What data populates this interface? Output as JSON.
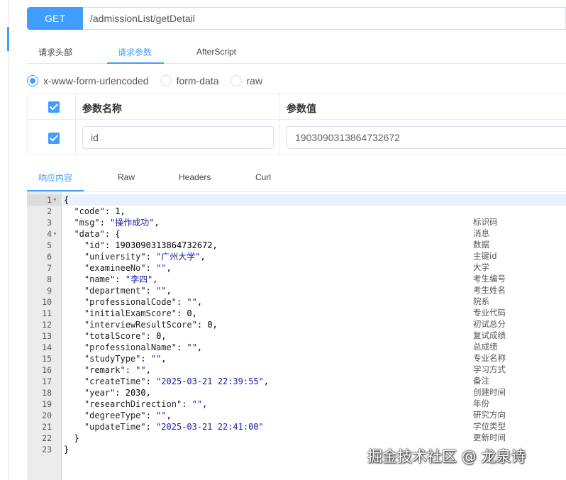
{
  "request": {
    "method": "GET",
    "url": "/admissionList/getDetail"
  },
  "request_tabs": [
    "请求头部",
    "请求参数",
    "AfterScript"
  ],
  "active_request_tab": "请求参数",
  "body_types": [
    "x-www-form-urlencoded",
    "form-data",
    "raw"
  ],
  "selected_body_type": "x-www-form-urlencoded",
  "params_table": {
    "headers": {
      "name": "参数名称",
      "value": "参数值"
    },
    "rows": [
      {
        "checked": true,
        "name": "id",
        "value": "1903090313864732672"
      }
    ]
  },
  "response_tabs": [
    "响应内容",
    "Raw",
    "Headers",
    "Curl"
  ],
  "active_response_tab": "响应内容",
  "editor": {
    "lines": [
      {
        "n": "1",
        "fold": true,
        "code": [
          [
            "p",
            "{"
          ]
        ],
        "comment": ""
      },
      {
        "n": "2",
        "code": [
          [
            "p",
            "  "
          ],
          [
            "k",
            "\"code\""
          ],
          [
            "p",
            ": "
          ],
          [
            "n",
            "1"
          ],
          [
            "p",
            ","
          ]
        ],
        "comment": "标识码"
      },
      {
        "n": "3",
        "code": [
          [
            "p",
            "  "
          ],
          [
            "k",
            "\"msg\""
          ],
          [
            "p",
            ": "
          ],
          [
            "s",
            "\"操作成功\""
          ],
          [
            "p",
            ","
          ]
        ],
        "comment": "消息"
      },
      {
        "n": "4",
        "fold": true,
        "code": [
          [
            "p",
            "  "
          ],
          [
            "k",
            "\"data\""
          ],
          [
            "p",
            ": {"
          ]
        ],
        "comment": "数据"
      },
      {
        "n": "5",
        "code": [
          [
            "p",
            "    "
          ],
          [
            "k",
            "\"id\""
          ],
          [
            "p",
            ": "
          ],
          [
            "n",
            "1903090313864732672"
          ],
          [
            "p",
            ","
          ]
        ],
        "comment": "主键id"
      },
      {
        "n": "6",
        "code": [
          [
            "p",
            "    "
          ],
          [
            "k",
            "\"university\""
          ],
          [
            "p",
            ": "
          ],
          [
            "s",
            "\"广州大学\""
          ],
          [
            "p",
            ","
          ]
        ],
        "comment": "大学"
      },
      {
        "n": "7",
        "code": [
          [
            "p",
            "    "
          ],
          [
            "k",
            "\"examineeNo\""
          ],
          [
            "p",
            ": "
          ],
          [
            "s",
            "\"\""
          ],
          [
            "p",
            ","
          ]
        ],
        "comment": "考生编号"
      },
      {
        "n": "8",
        "code": [
          [
            "p",
            "    "
          ],
          [
            "k",
            "\"name\""
          ],
          [
            "p",
            ": "
          ],
          [
            "s",
            "\"李四\""
          ],
          [
            "p",
            ","
          ]
        ],
        "comment": "考生姓名"
      },
      {
        "n": "9",
        "code": [
          [
            "p",
            "    "
          ],
          [
            "k",
            "\"department\""
          ],
          [
            "p",
            ": "
          ],
          [
            "s",
            "\"\""
          ],
          [
            "p",
            ","
          ]
        ],
        "comment": "院系"
      },
      {
        "n": "10",
        "code": [
          [
            "p",
            "    "
          ],
          [
            "k",
            "\"professionalCode\""
          ],
          [
            "p",
            ": "
          ],
          [
            "s",
            "\"\""
          ],
          [
            "p",
            ","
          ]
        ],
        "comment": "专业代码"
      },
      {
        "n": "11",
        "code": [
          [
            "p",
            "    "
          ],
          [
            "k",
            "\"initialExamScore\""
          ],
          [
            "p",
            ": "
          ],
          [
            "n",
            "0"
          ],
          [
            "p",
            ","
          ]
        ],
        "comment": "初试总分"
      },
      {
        "n": "12",
        "code": [
          [
            "p",
            "    "
          ],
          [
            "k",
            "\"interviewResultScore\""
          ],
          [
            "p",
            ": "
          ],
          [
            "n",
            "0"
          ],
          [
            "p",
            ","
          ]
        ],
        "comment": "复试成绩"
      },
      {
        "n": "13",
        "code": [
          [
            "p",
            "    "
          ],
          [
            "k",
            "\"totalScore\""
          ],
          [
            "p",
            ": "
          ],
          [
            "n",
            "0"
          ],
          [
            "p",
            ","
          ]
        ],
        "comment": "总成绩"
      },
      {
        "n": "14",
        "code": [
          [
            "p",
            "    "
          ],
          [
            "k",
            "\"professionalName\""
          ],
          [
            "p",
            ": "
          ],
          [
            "s",
            "\"\""
          ],
          [
            "p",
            ","
          ]
        ],
        "comment": "专业名称"
      },
      {
        "n": "15",
        "code": [
          [
            "p",
            "    "
          ],
          [
            "k",
            "\"studyType\""
          ],
          [
            "p",
            ": "
          ],
          [
            "s",
            "\"\""
          ],
          [
            "p",
            ","
          ]
        ],
        "comment": "学习方式"
      },
      {
        "n": "16",
        "code": [
          [
            "p",
            "    "
          ],
          [
            "k",
            "\"remark\""
          ],
          [
            "p",
            ": "
          ],
          [
            "s",
            "\"\""
          ],
          [
            "p",
            ","
          ]
        ],
        "comment": "备注"
      },
      {
        "n": "17",
        "code": [
          [
            "p",
            "    "
          ],
          [
            "k",
            "\"createTime\""
          ],
          [
            "p",
            ": "
          ],
          [
            "s",
            "\"2025-03-21 22:39:55\""
          ],
          [
            "p",
            ","
          ]
        ],
        "comment": "创建时间"
      },
      {
        "n": "18",
        "code": [
          [
            "p",
            "    "
          ],
          [
            "k",
            "\"year\""
          ],
          [
            "p",
            ": "
          ],
          [
            "n",
            "2030"
          ],
          [
            "p",
            ","
          ]
        ],
        "comment": "年份"
      },
      {
        "n": "19",
        "code": [
          [
            "p",
            "    "
          ],
          [
            "k",
            "\"researchDirection\""
          ],
          [
            "p",
            ": "
          ],
          [
            "s",
            "\"\""
          ],
          [
            "p",
            ","
          ]
        ],
        "comment": "研究方向"
      },
      {
        "n": "20",
        "code": [
          [
            "p",
            "    "
          ],
          [
            "k",
            "\"degreeType\""
          ],
          [
            "p",
            ": "
          ],
          [
            "s",
            "\"\""
          ],
          [
            "p",
            ","
          ]
        ],
        "comment": "学位类型"
      },
      {
        "n": "21",
        "code": [
          [
            "p",
            "    "
          ],
          [
            "k",
            "\"updateTime\""
          ],
          [
            "p",
            ": "
          ],
          [
            "s",
            "\"2025-03-21 22:41:00\""
          ]
        ],
        "comment": "更新时间"
      },
      {
        "n": "22",
        "code": [
          [
            "p",
            "  }"
          ]
        ],
        "comment": ""
      },
      {
        "n": "23",
        "code": [
          [
            "p",
            "}"
          ]
        ],
        "comment": ""
      }
    ]
  },
  "watermark": "掘金技术社区 @ 龙泉诗",
  "colors": {
    "accent": "#409eff",
    "string": "#1a1aa6",
    "gutter": "#ebebeb"
  }
}
